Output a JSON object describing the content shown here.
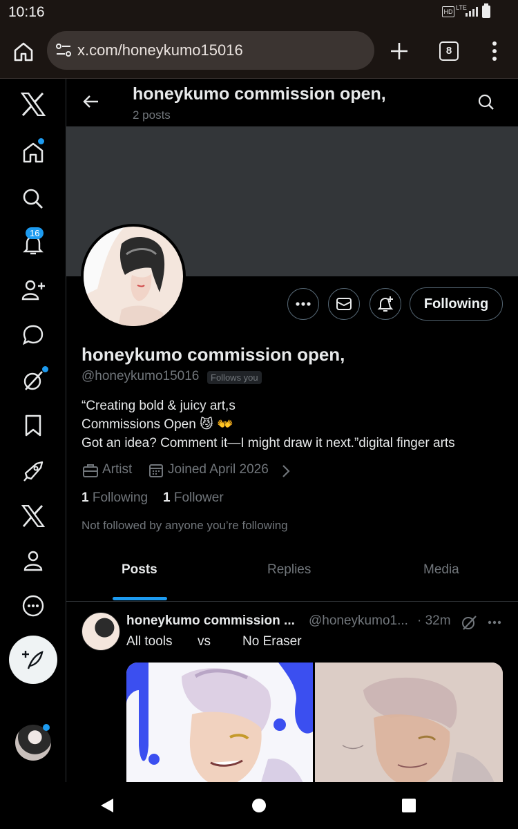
{
  "status": {
    "time": "10:16",
    "hd": "HD",
    "lte": "LTE"
  },
  "browser": {
    "url": "x.com/honeykumo15016",
    "tab_count": "8"
  },
  "sidebar": {
    "notification_count": "16"
  },
  "header": {
    "title": "honeykumo commission open,",
    "post_count": "2 posts"
  },
  "profile": {
    "name": "honeykumo commission open,",
    "handle": "@honeykumo15016",
    "follows_you": "Follows you",
    "bio_line1": "“Creating bold & juicy art,s",
    "bio_line2": "Commissions Open 😼 👐",
    "bio_line3": "Got an idea? Comment it—I might draw it next.”digital finger arts",
    "category": "Artist",
    "joined": "Joined April 2026",
    "following_count": "1",
    "following_label": "Following",
    "followers_count": "1",
    "followers_label": "Follower",
    "mutuals_note": "Not followed by anyone you’re following",
    "follow_button": "Following"
  },
  "tabs": [
    "Posts",
    "Replies",
    "Media"
  ],
  "post": {
    "author": "honeykumo commission ...",
    "handle": "@honeykumo1...",
    "time": "· 32m",
    "text_left": "All tools",
    "text_mid": "vs",
    "text_right": "No Eraser"
  },
  "colors": {
    "accent": "#1d9bf0",
    "banner": "#333639",
    "chrome": "#1b1512"
  }
}
